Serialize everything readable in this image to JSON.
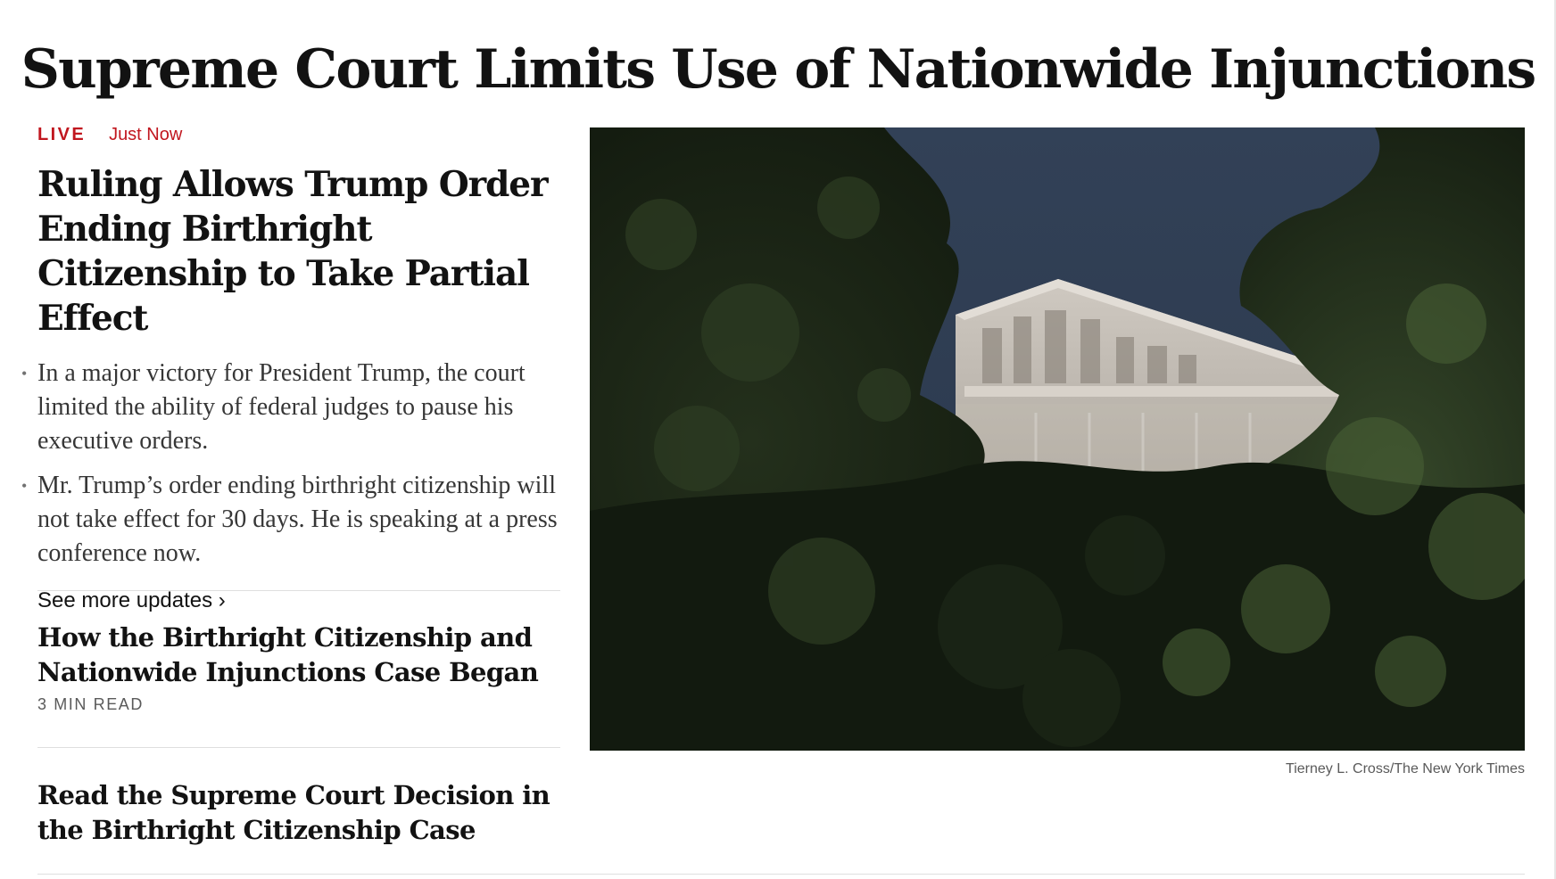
{
  "banner": {
    "headline": "Supreme Court Limits Use of Nationwide Injunctions"
  },
  "lead": {
    "live_label": "LIVE",
    "timestamp": "Just Now",
    "headline": "Ruling Allows Trump Order Ending Birthright Citizenship to Take Partial Effect",
    "bullets": [
      "In a major victory for President Trump, the court limited the ability of federal judges to pause his executive orders.",
      "Mr. Trump’s order ending birthright citizenship will not take effect for 30 days. He is speaking at a press conference now."
    ],
    "bullet_marker": "•",
    "see_more": "See more updates ›"
  },
  "stories": [
    {
      "headline": "How the Birthright Citizenship and Nationwide Injunctions Case Began",
      "meta": "3 MIN READ"
    },
    {
      "headline": "Read the Supreme Court Decision in the Birthright Citizenship Case",
      "meta": ""
    }
  ],
  "photo": {
    "credit": "Tierney L. Cross/The New York Times",
    "subject": "supreme-court-pediment-through-trees"
  },
  "colors": {
    "live_red": "#c1171f",
    "headline_text": "#121212",
    "body_text": "#363636",
    "meta_text": "#5a5a5a",
    "divider": "#dfdfdf",
    "sky": "#2f3d52",
    "foliage_dark": "#141d12",
    "marble": "#bdb6ad"
  },
  "icons": {
    "bullet": "bullet-dot-icon",
    "chevron": "chevron-right-icon"
  }
}
